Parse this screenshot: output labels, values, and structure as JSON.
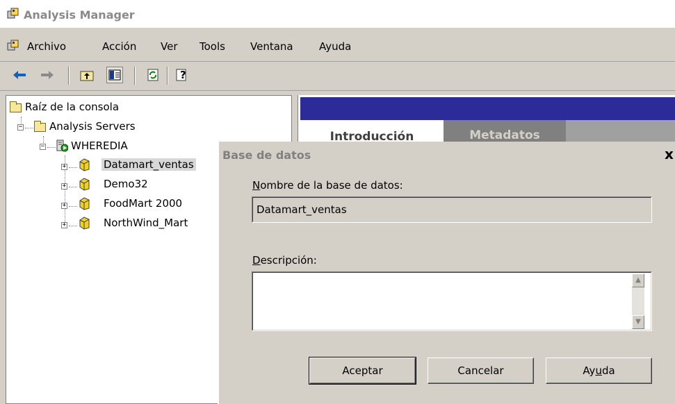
{
  "window": {
    "title": "Analysis Manager"
  },
  "menu": {
    "items": [
      "Archivo",
      "Acción",
      "Ver",
      "Tools",
      "Ventana",
      "Ayuda"
    ]
  },
  "tree": {
    "root": "Raíz de la consola",
    "servers": "Analysis Servers",
    "server": "WHEREDIA",
    "databases": [
      "Datamart_ventas",
      "Demo32",
      "FoodMart 2000",
      "NorthWind_Mart"
    ]
  },
  "tabs": [
    "Introducción",
    "Metadatos"
  ],
  "dialog": {
    "title": "Base de datos",
    "close": "x",
    "name_label_u": "N",
    "name_label_rest": "ombre de la base de datos:",
    "name_value": "Datamart_ventas",
    "desc_label_u": "D",
    "desc_label_rest": "escripción:",
    "desc_value": "",
    "buttons": {
      "ok": "Aceptar",
      "cancel": "Cancelar",
      "help_pre": "Ay",
      "help_u": "u",
      "help_post": "da"
    }
  }
}
